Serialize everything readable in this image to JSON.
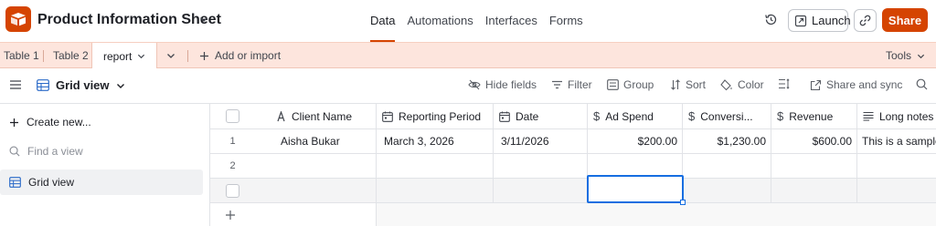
{
  "app": {
    "title": "Product Information Sheet",
    "brand_color": "#d54401"
  },
  "nav": {
    "items": [
      {
        "label": "Data",
        "active": true
      },
      {
        "label": "Automations",
        "active": false
      },
      {
        "label": "Interfaces",
        "active": false
      },
      {
        "label": "Forms",
        "active": false
      }
    ]
  },
  "header_actions": {
    "launch_label": "Launch",
    "share_label": "Share"
  },
  "tabs": {
    "items": [
      {
        "label": "Table 1"
      },
      {
        "label": "Table 2"
      },
      {
        "label": "report",
        "active": true
      }
    ],
    "add_label": "Add or import",
    "tools_label": "Tools"
  },
  "toolbar": {
    "view_name": "Grid view",
    "hide_fields": "Hide fields",
    "filter": "Filter",
    "group": "Group",
    "sort": "Sort",
    "color": "Color",
    "share_sync": "Share and sync"
  },
  "sidebar": {
    "create_new": "Create new...",
    "find_view": "Find a view",
    "views": [
      {
        "label": "Grid view",
        "active": true
      }
    ]
  },
  "table": {
    "columns": [
      {
        "label": "Client Name",
        "icon": "text-icon"
      },
      {
        "label": "Reporting Period",
        "icon": "calendar-icon"
      },
      {
        "label": "Date",
        "icon": "calendar-icon"
      },
      {
        "label": "Ad Spend",
        "icon": "currency-icon"
      },
      {
        "label": "Conversi...",
        "icon": "currency-icon"
      },
      {
        "label": "Revenue",
        "icon": "currency-icon"
      },
      {
        "label": "Long notes",
        "icon": "long-text-icon"
      }
    ],
    "rows": [
      {
        "num": "1",
        "client_name": "Aisha Bukar",
        "reporting_period": "March 3, 2026",
        "date": "3/11/2026",
        "ad_spend": "$200.00",
        "conversions": "$1,230.00",
        "revenue": "$600.00",
        "long_notes": "This is a sample o"
      },
      {
        "num": "2",
        "client_name": "",
        "reporting_period": "",
        "date": "",
        "ad_spend": "",
        "conversions": "",
        "revenue": "",
        "long_notes": ""
      }
    ]
  }
}
